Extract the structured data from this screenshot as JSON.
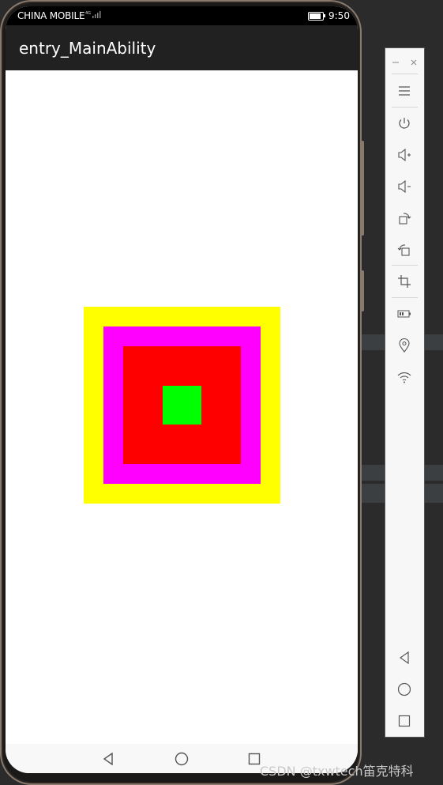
{
  "statusbar": {
    "carrier": "CHINA MOBILE",
    "network": "4G",
    "time": "9:50"
  },
  "appbar": {
    "title": "entry_MainAbility"
  },
  "squares": [
    {
      "name": "yellow",
      "color": "#ffff00"
    },
    {
      "name": "magenta",
      "color": "#ff00ff"
    },
    {
      "name": "red",
      "color": "#ff0000"
    },
    {
      "name": "green",
      "color": "#00ff00"
    }
  ],
  "navbar": {
    "icons": [
      "back-icon",
      "home-icon",
      "recents-icon"
    ]
  },
  "emulator_toolbar": {
    "icons": [
      "minimize-icon",
      "close-icon",
      "menu-icon",
      "power-icon",
      "volume-up-icon",
      "volume-down-icon",
      "rotate-right-icon",
      "rotate-left-icon",
      "crop-icon",
      "battery-icon",
      "location-icon",
      "wifi-icon",
      "back-icon",
      "home-icon",
      "recents-icon"
    ]
  },
  "watermark": "CSDN @txwtech笛克特科"
}
